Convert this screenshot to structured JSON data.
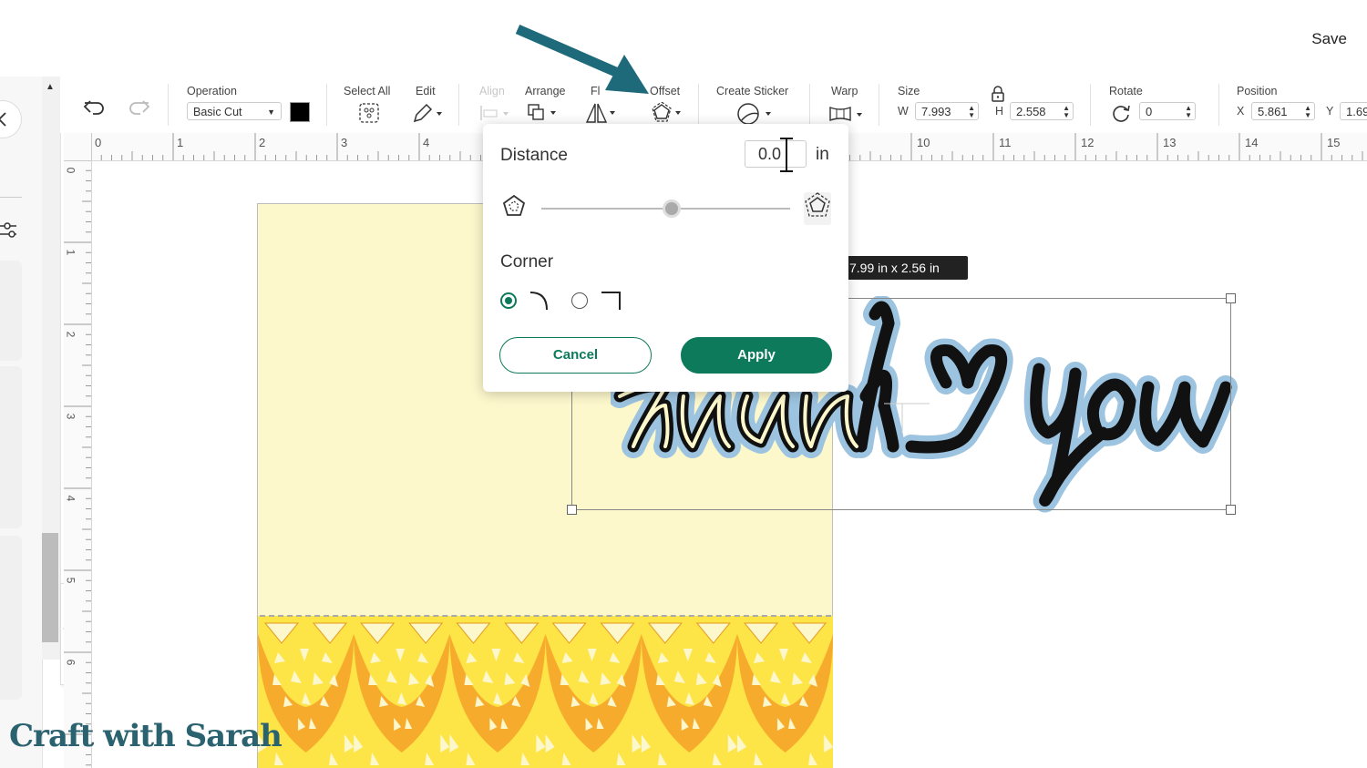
{
  "header": {
    "save_label": "Save"
  },
  "toolbar": {
    "operation": {
      "label": "Operation",
      "value": "Basic Cut",
      "color": "#000000"
    },
    "select_all": {
      "label": "Select All"
    },
    "edit": {
      "label": "Edit"
    },
    "align": {
      "label": "Align"
    },
    "arrange": {
      "label": "Arrange"
    },
    "flip": {
      "label": "Fl"
    },
    "offset": {
      "label": "Offset"
    },
    "create_sticker": {
      "label": "Create Sticker"
    },
    "warp": {
      "label": "Warp"
    },
    "size": {
      "label": "Size",
      "w_label": "W",
      "w_value": "7.993",
      "h_label": "H",
      "h_value": "2.558"
    },
    "rotate": {
      "label": "Rotate",
      "value": "0"
    },
    "position": {
      "label": "Position",
      "x_label": "X",
      "x_value": "5.861",
      "y_label": "Y",
      "y_value": "1.69"
    }
  },
  "rulers": {
    "horizontal": [
      "0",
      "1",
      "2",
      "3",
      "4",
      "10",
      "11",
      "12",
      "13",
      "14",
      "15"
    ],
    "vertical": [
      "0",
      "1",
      "2",
      "3",
      "4",
      "5",
      "6"
    ]
  },
  "offset_popover": {
    "distance_label": "Distance",
    "distance_value": "0.0",
    "unit": "in",
    "slider_value_fraction": 0.52,
    "corner_label": "Corner",
    "corner_selected": "rounded",
    "cancel_label": "Cancel",
    "apply_label": "Apply"
  },
  "selection": {
    "dimensions": "7.99  in x 2.56  in",
    "text": "thank you"
  },
  "watermark": "Craft with Sarah",
  "colors": {
    "accent": "#0c7a5b",
    "arrow": "#1e6a7a",
    "card": "#fdf7cc",
    "lace_light": "#fde547",
    "lace_dark": "#f6ab2c"
  }
}
